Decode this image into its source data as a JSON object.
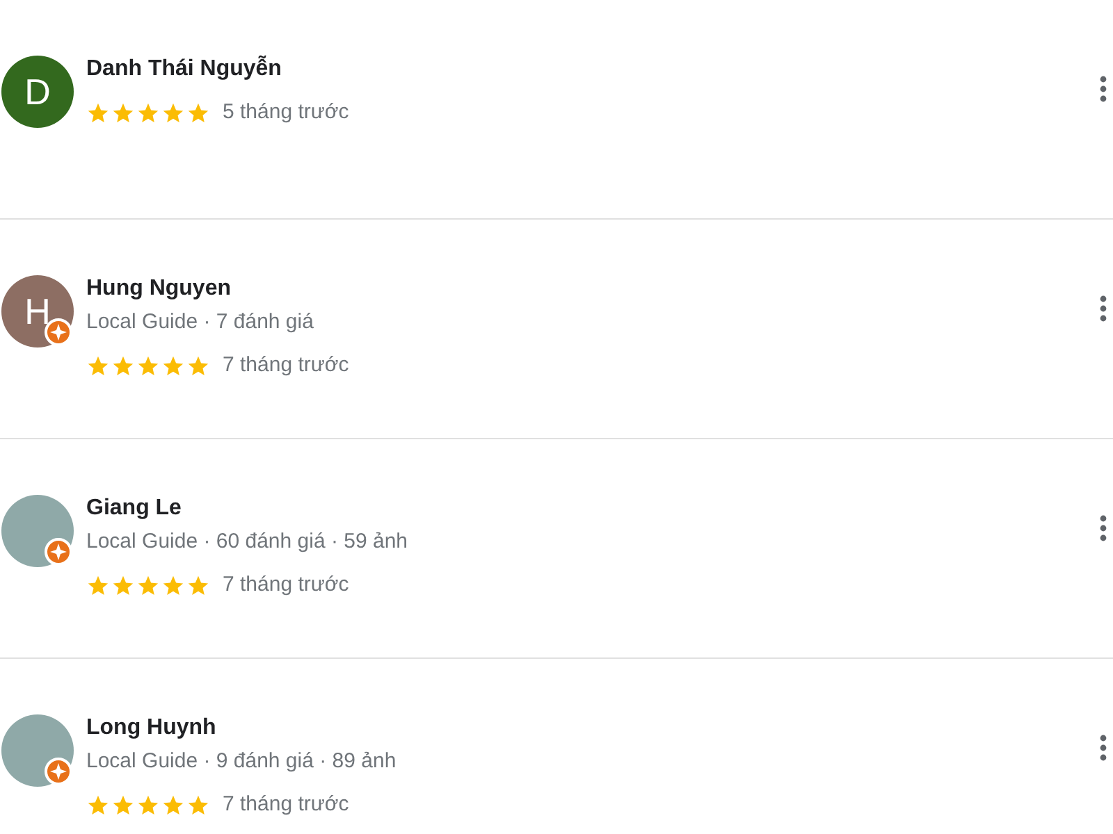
{
  "reviews": [
    {
      "name": "Danh Thái Nguyễn",
      "avatar": {
        "kind": "letter",
        "letter": "D",
        "color": "#33691e"
      },
      "local_guide": false,
      "stars": 5,
      "time": "5 tháng trước"
    },
    {
      "name": "Hung Nguyen",
      "avatar": {
        "kind": "letter",
        "letter": "H",
        "color": "#8d6e63"
      },
      "local_guide": true,
      "meta": "Local Guide · 7 đánh giá",
      "stars": 5,
      "time": "7 tháng trước"
    },
    {
      "name": "Giang Le",
      "avatar": {
        "kind": "photo"
      },
      "local_guide": true,
      "meta": "Local Guide · 60 đánh giá · 59 ảnh",
      "stars": 5,
      "time": "7 tháng trước"
    },
    {
      "name": "Long Huynh",
      "avatar": {
        "kind": "photo"
      },
      "local_guide": true,
      "meta": "Local Guide · 9 đánh giá · 89 ảnh",
      "stars": 5,
      "time": "7 tháng trước"
    }
  ]
}
